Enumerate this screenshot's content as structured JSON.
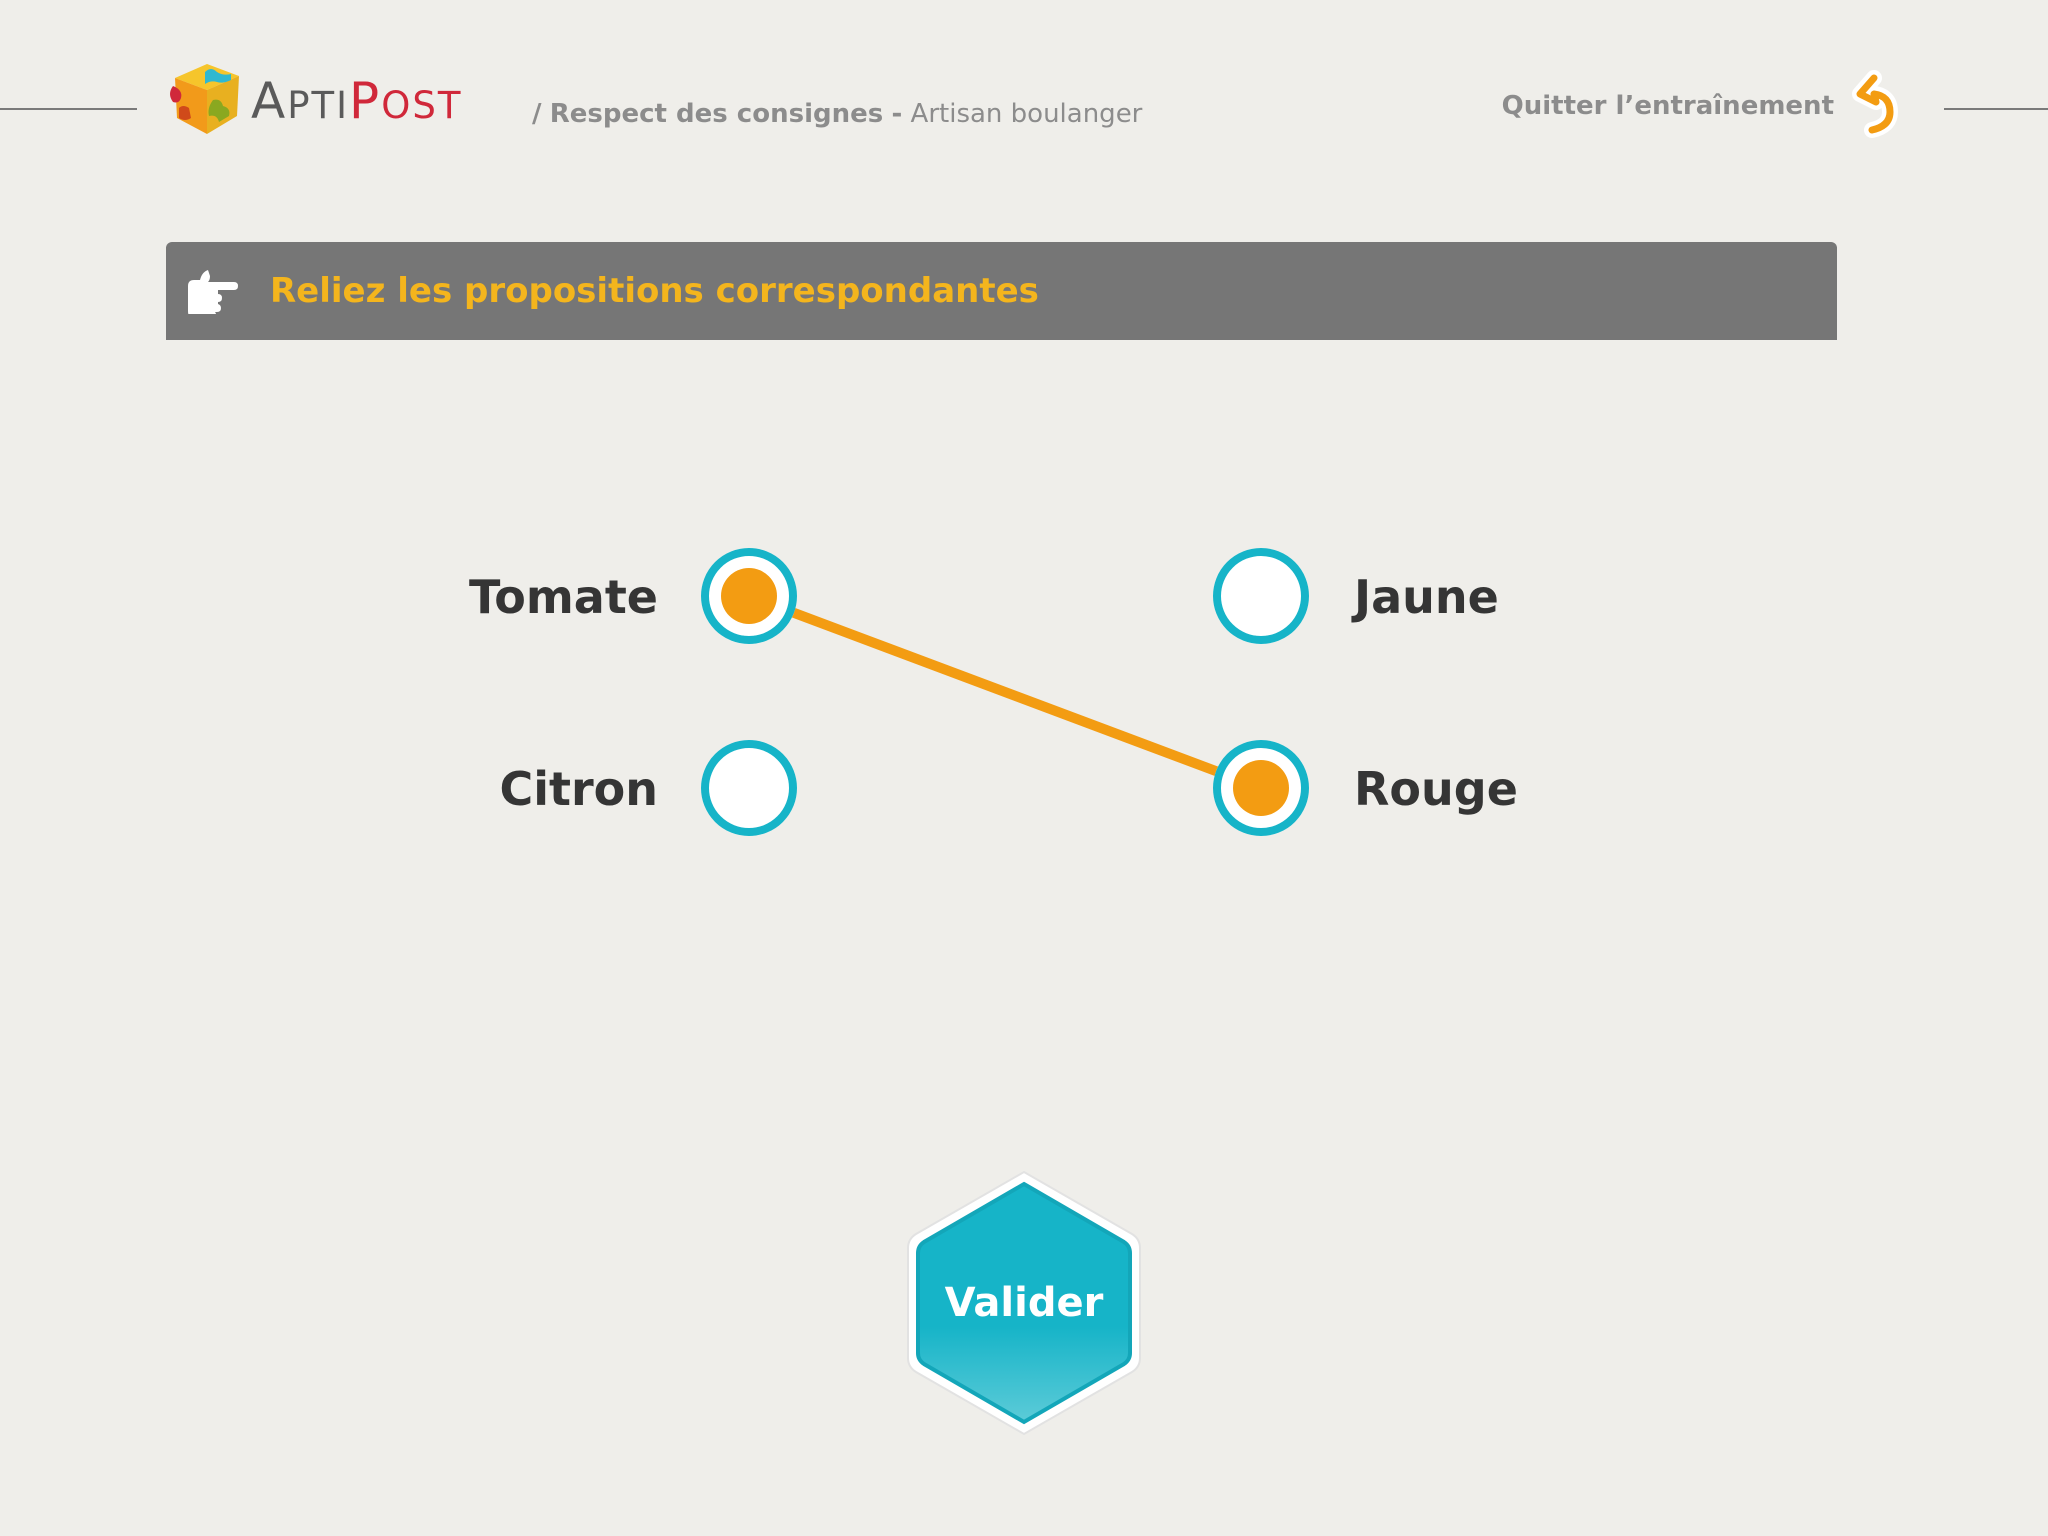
{
  "header": {
    "logo": {
      "text_first": "Apti",
      "text_second": "Post"
    },
    "breadcrumb": {
      "separator": "/",
      "section": "Respect des consignes",
      "dash": "-",
      "job": "Artisan boulanger"
    },
    "quit_label": "Quitter l’entraînement"
  },
  "instruction": {
    "text": "Reliez les propositions correspondantes",
    "icon": "pointing-hand-icon"
  },
  "matching": {
    "left_items": [
      {
        "label": "Tomate",
        "selected": true
      },
      {
        "label": "Citron",
        "selected": false
      }
    ],
    "right_items": [
      {
        "label": "Jaune",
        "selected": false
      },
      {
        "label": "Rouge",
        "selected": true
      }
    ],
    "connections": [
      {
        "from": "Tomate",
        "to": "Rouge"
      }
    ]
  },
  "validate_button": {
    "label": "Valider"
  },
  "colors": {
    "background": "#efeeea",
    "accent_orange": "#f39c12",
    "accent_teal": "#16b4c8",
    "instruction_bg": "#767676",
    "instruction_text": "#f4b51d",
    "brand_red": "#d0283a"
  }
}
